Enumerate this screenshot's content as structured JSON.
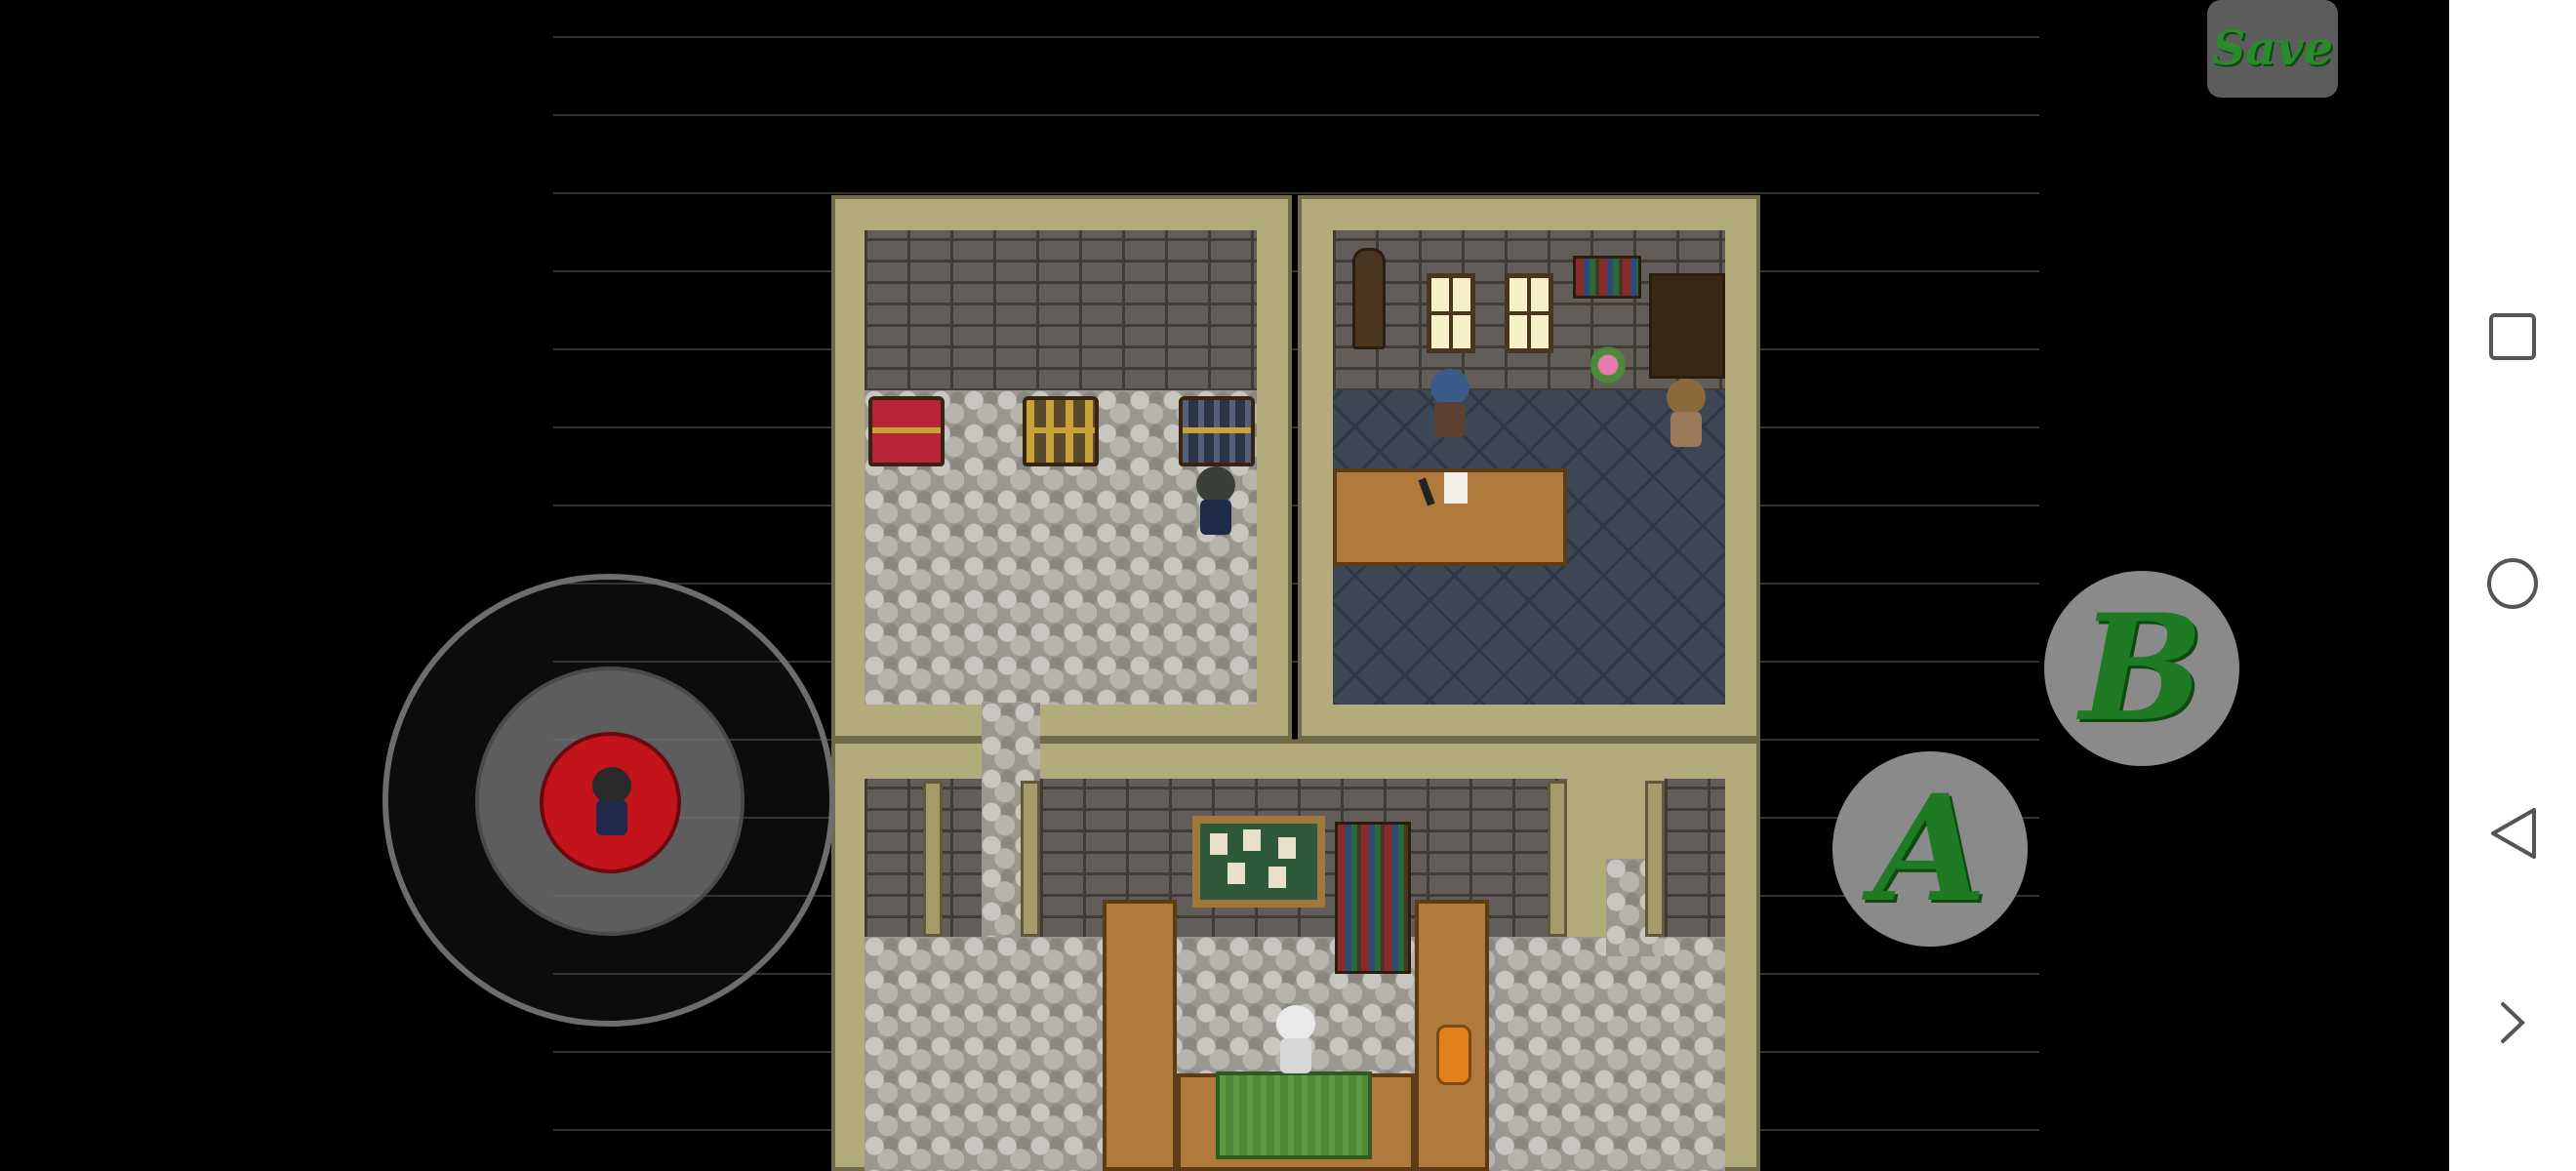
{
  "controls": {
    "save_label": "Save",
    "a_label": "A",
    "b_label": "B"
  },
  "navbar": {
    "icons": [
      "square-icon",
      "circle-icon",
      "back-triangle-icon",
      "chevron-right-icon"
    ]
  },
  "colors": {
    "button_text": "#1f7a24",
    "joystick_knob": "#c3141c",
    "button_bg": "#8a8a8a",
    "navbar_bg": "#ffffff"
  }
}
